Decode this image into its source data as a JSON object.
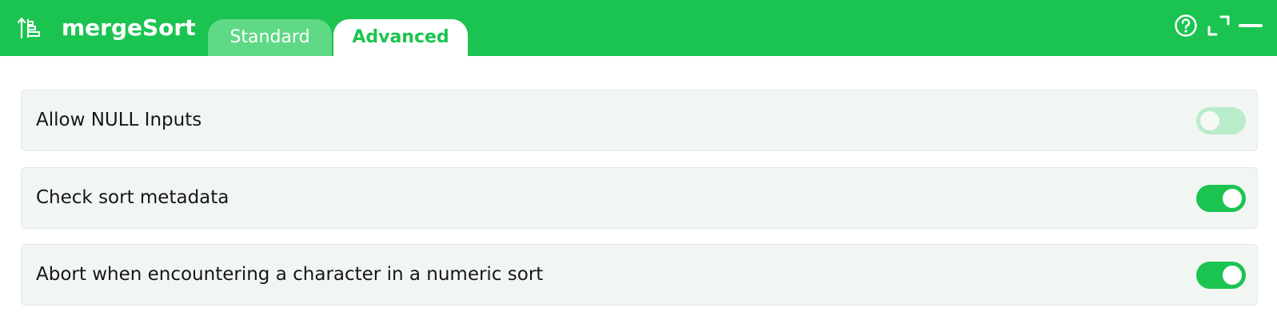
{
  "app": {
    "title": "mergeSort",
    "icon": "sort-ascending-icon"
  },
  "tabs": [
    {
      "label": "Standard",
      "active": false
    },
    {
      "label": "Advanced",
      "active": true
    }
  ],
  "header_actions": [
    {
      "icon": "help-icon"
    },
    {
      "icon": "expand-icon"
    },
    {
      "icon": "minimize-icon"
    }
  ],
  "settings": [
    {
      "label": "Allow NULL Inputs",
      "enabled": false
    },
    {
      "label": "Check sort metadata",
      "enabled": true
    },
    {
      "label": "Abort when encountering a character in a numeric sort",
      "enabled": true
    }
  ],
  "colors": {
    "accent": "#1bc451",
    "accent_light": "#b9ecc8",
    "panel_bg": "#f2f6f3"
  }
}
